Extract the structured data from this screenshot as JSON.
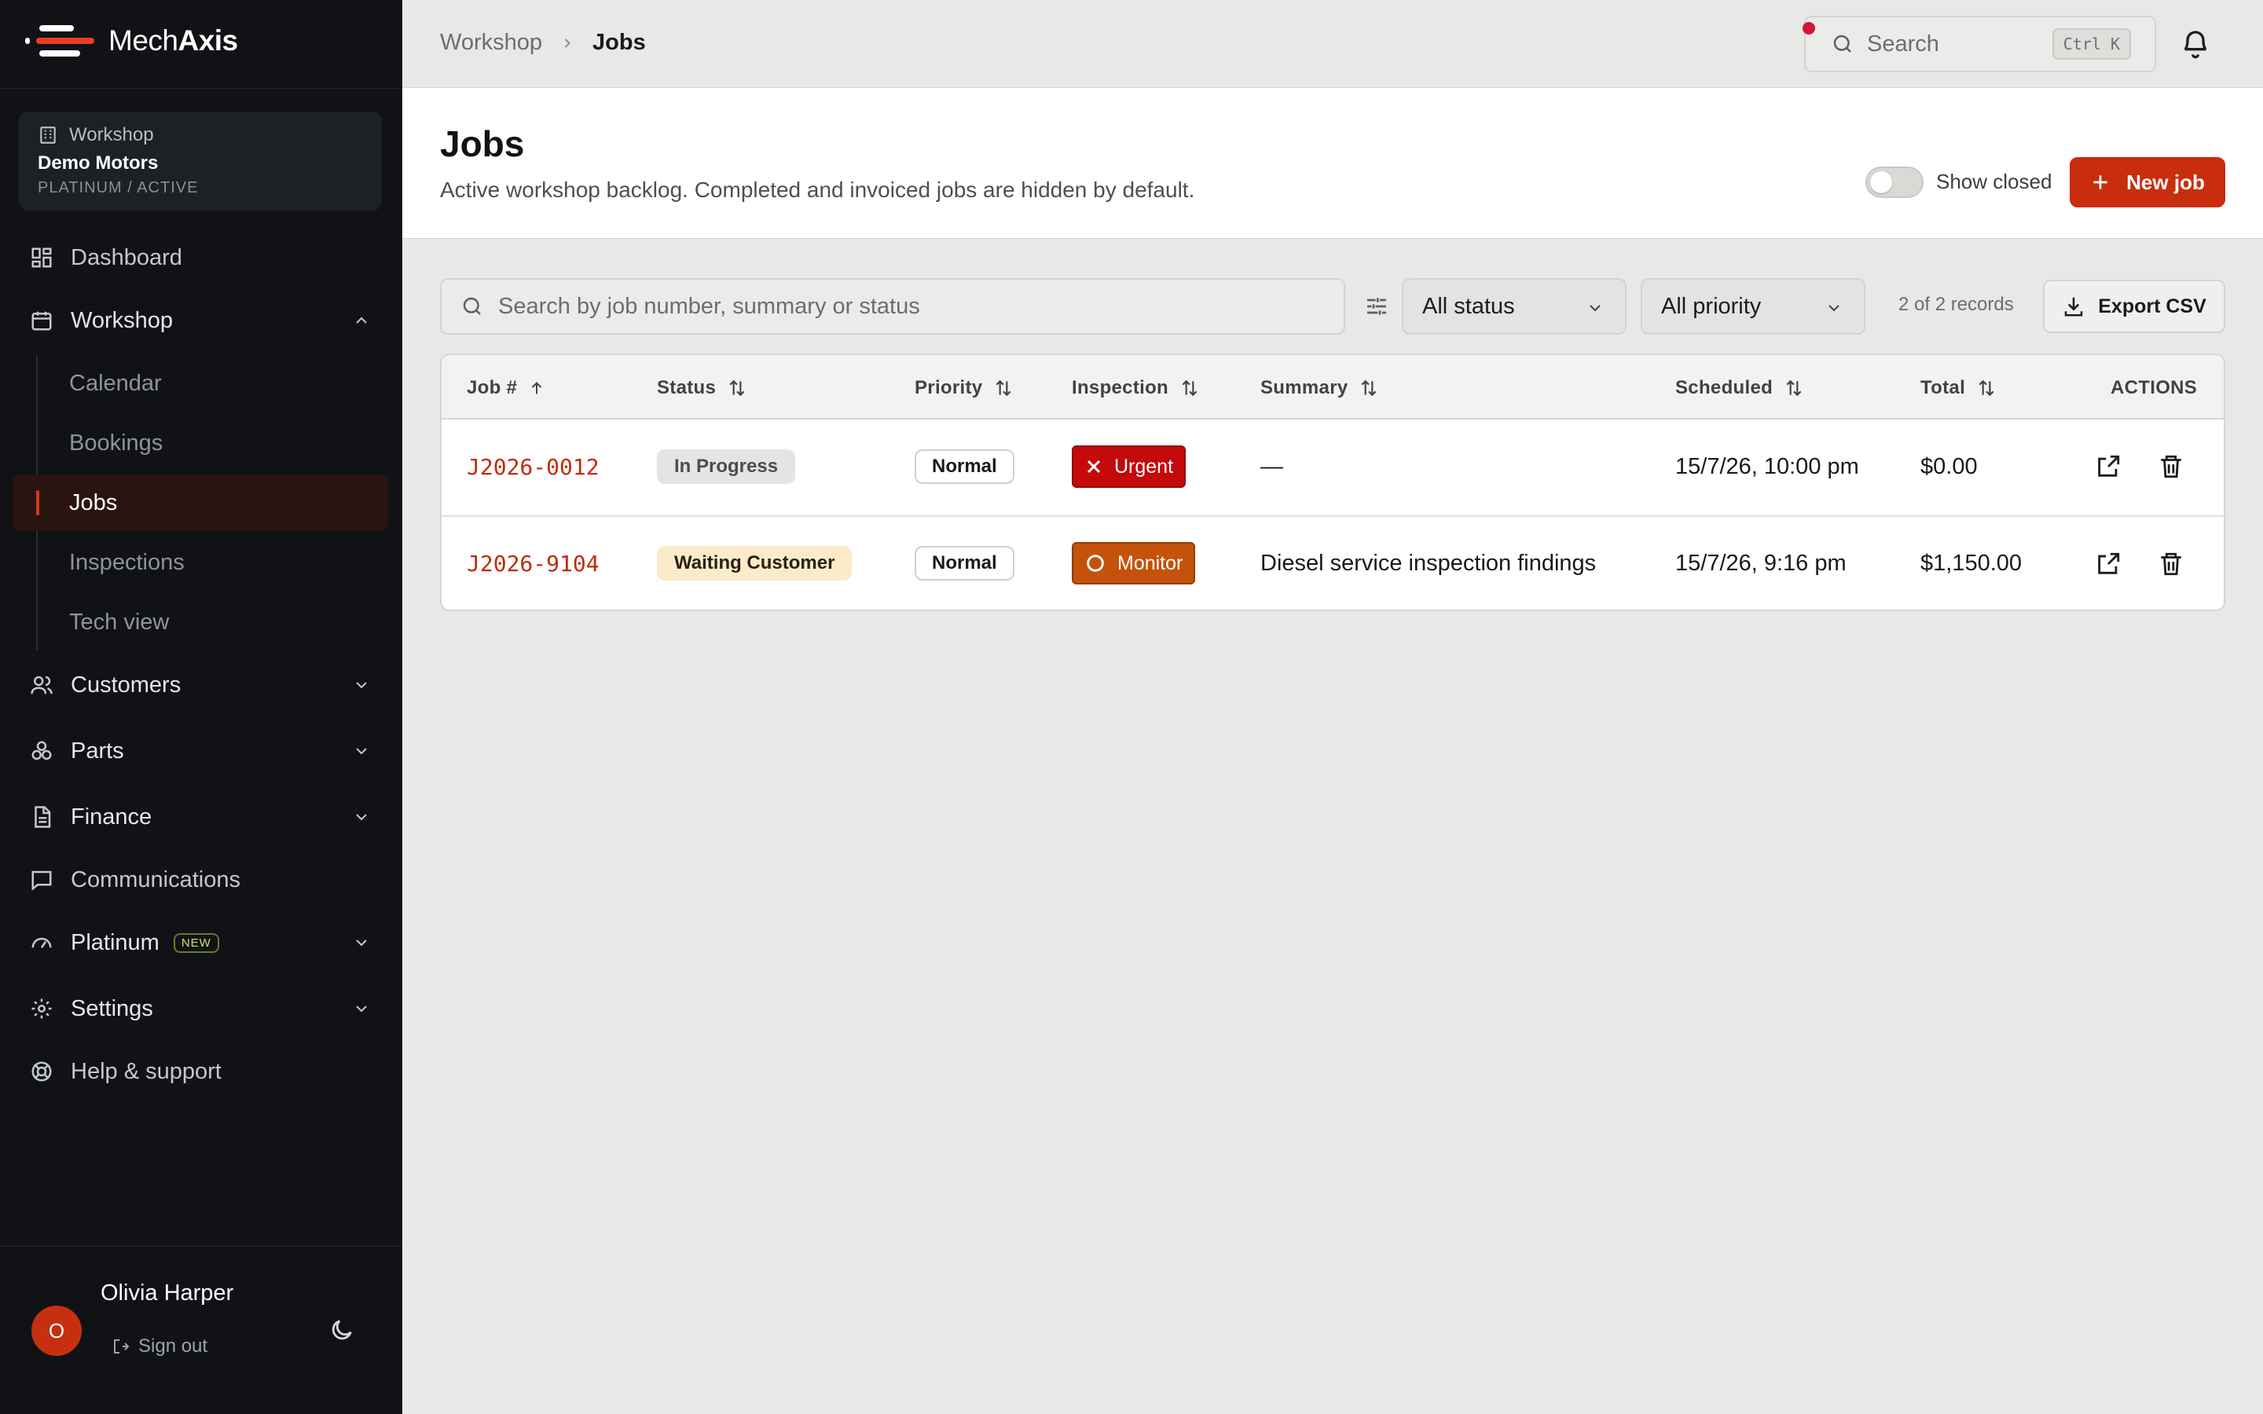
{
  "app": {
    "brand_name_light": "Mech",
    "brand_name_bold": "Axis",
    "accent": "#c92d0d"
  },
  "workspace": {
    "label": "Workshop",
    "name": "Demo Motors",
    "tier": "PLATINUM / ACTIVE"
  },
  "sidebar": {
    "dashboard": "Dashboard",
    "workshop": "Workshop",
    "workshop_children": [
      "Calendar",
      "Bookings",
      "Jobs",
      "Inspections",
      "Tech view"
    ],
    "customers": "Customers",
    "parts": "Parts",
    "finance": "Finance",
    "communications": "Communications",
    "platinum": "Platinum",
    "platinum_badge": "NEW",
    "settings": "Settings",
    "help": "Help & support"
  },
  "user": {
    "initial": "O",
    "name": "Olivia Harper",
    "signout": "Sign out"
  },
  "topbar": {
    "breadcrumb": [
      "Workshop",
      "Jobs"
    ],
    "search_placeholder": "Search",
    "shortcut": "Ctrl K"
  },
  "page": {
    "title": "Jobs",
    "subtitle": "Active workshop backlog. Completed and invoiced jobs are hidden by default.",
    "show_closed_label": "Show closed",
    "show_closed": false,
    "new_job_label": "New job"
  },
  "filters": {
    "search_placeholder": "Search by job number, summary or status",
    "status_value": "All status",
    "priority_value": "All priority",
    "records": "2 of 2 records",
    "export_label": "Export CSV"
  },
  "table": {
    "headers": {
      "job": "Job #",
      "status": "Status",
      "priority": "Priority",
      "inspection": "Inspection",
      "summary": "Summary",
      "scheduled": "Scheduled",
      "total": "Total",
      "actions": "ACTIONS"
    },
    "rows": [
      {
        "job": "J2026-0012",
        "status": "In Progress",
        "priority": "Normal",
        "inspection": "Urgent",
        "summary": "—",
        "scheduled": "15/7/26, 10:00 pm",
        "total": "$0.00"
      },
      {
        "job": "J2026-9104",
        "status": "Waiting Customer",
        "priority": "Normal",
        "inspection": "Monitor",
        "summary": "Diesel service inspection findings",
        "scheduled": "15/7/26, 9:16 pm",
        "total": "$1,150.00"
      }
    ]
  },
  "colors": {
    "status_in_progress": "#e4e4e2",
    "status_waiting": "#fbebc9",
    "inspection_urgent": "#c40a0a",
    "inspection_monitor": "#c4520a"
  }
}
